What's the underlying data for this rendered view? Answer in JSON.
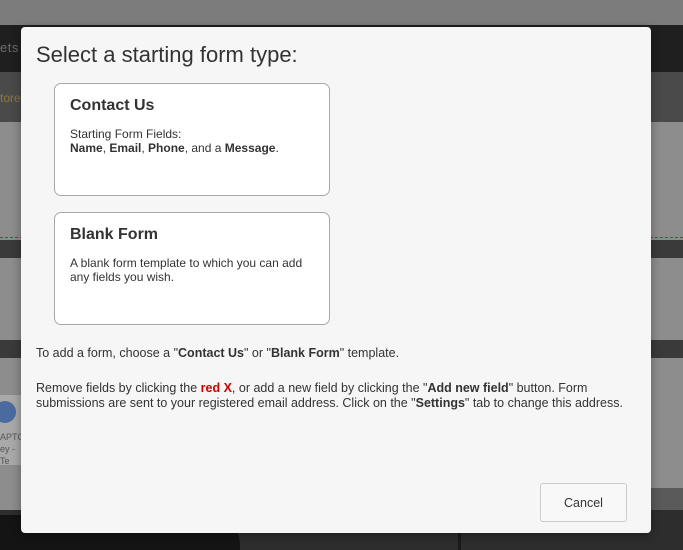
{
  "background": {
    "nav_fragment": "ets",
    "subnav_fragment": "tore",
    "captcha_text_1": "APTC",
    "captcha_text_2": "ey - Te"
  },
  "modal": {
    "title": "Select a starting form type:",
    "cards": [
      {
        "title": "Contact Us",
        "desc_line1": "Starting Form Fields:",
        "field_name": "Name",
        "sep1": ", ",
        "field_email": "Email",
        "sep2": ", ",
        "field_phone": "Phone",
        "sep3": ", and a ",
        "field_message": "Message",
        "end": "."
      },
      {
        "title": "Blank Form",
        "desc": "A blank form template to which you can add any fields you wish."
      }
    ],
    "instruction1": {
      "pre": "To add a form, choose a \"",
      "contact": "Contact Us",
      "mid": "\" or \"",
      "blank": "Blank Form",
      "post": "\" template."
    },
    "instruction2": {
      "pre": "Remove fields by clicking the ",
      "red_x": "red X",
      "mid1": ", or add a new field by clicking the \"",
      "add_new": "Add new field",
      "mid2": "\" button. Form submissions are sent to your registered email address. Click on the \"",
      "settings": "Settings",
      "post": "\" tab to change this address."
    },
    "cancel_label": "Cancel"
  },
  "colors": {
    "modal_bg": "#f6f6f6",
    "overlay": "#8a8a8a",
    "red_x": "#cc0000",
    "text": "#333333"
  }
}
